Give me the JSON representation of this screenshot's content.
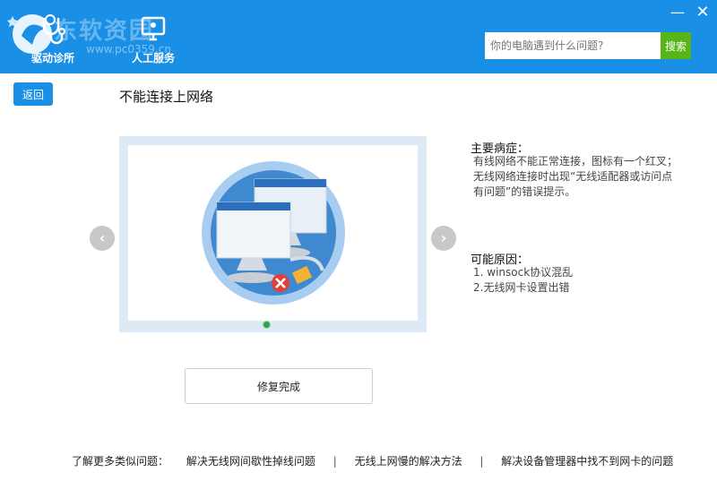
{
  "header": {
    "watermark": "东软资园",
    "watermark_sub": "www.pc0359.cn",
    "nav": [
      {
        "label": "驱动诊所",
        "icon": "stethoscope-icon"
      },
      {
        "label": "人工服务",
        "icon": "monitor-service-icon"
      }
    ],
    "window": {
      "minimize": "—",
      "close": "✕"
    }
  },
  "search": {
    "placeholder": "你的电脑遇到什么问题?",
    "button_label": "搜索"
  },
  "back_label": "返回",
  "title": "不能连接上网络",
  "carousel": {
    "prev": "‹",
    "next": "›"
  },
  "symptoms": {
    "title": "主要病症：",
    "text": "有线网络不能正常连接，图标有一个红叉；无线网络连接时出现“无线适配器或访问点有问题”的错误提示。"
  },
  "causes": {
    "title": "可能原因：",
    "items": [
      "1. winsock协议混乱",
      "2.无线网卡设置出错"
    ]
  },
  "fix_label": "修复完成",
  "related": {
    "label": "了解更多类似问题：",
    "links": [
      "解决无线网间歇性掉线问题",
      "无线上网慢的解决方法",
      "解决设备管理器中找不到网卡的问题"
    ],
    "separator": "|"
  },
  "colors": {
    "header": "#1a8fe6",
    "search_button": "#57b51a",
    "active_dot": "#2ea44f"
  }
}
